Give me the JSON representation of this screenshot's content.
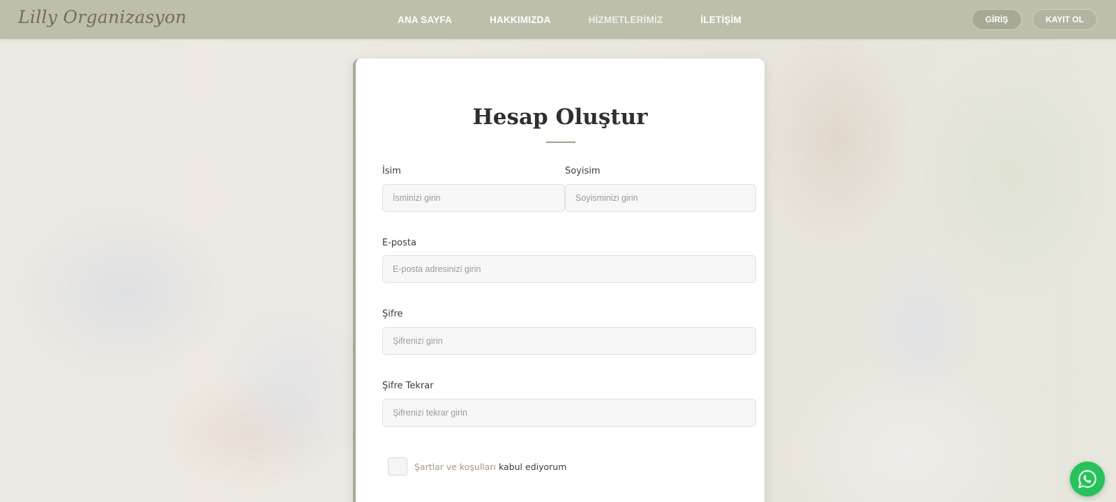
{
  "brand": {
    "name": "Lilly Organizasyon"
  },
  "nav": {
    "links": [
      {
        "label": "ANA SAYFA"
      },
      {
        "label": "HAKKIMIZDA"
      },
      {
        "label": "HİZMETLERİMİZ"
      },
      {
        "label": "İLETİŞİM"
      }
    ],
    "login_label": "GİRİŞ",
    "register_label": "KAYIT OL"
  },
  "form": {
    "title": "Hesap Oluştur",
    "first_name": {
      "label": "İsim",
      "placeholder": "İsminizi girin"
    },
    "last_name": {
      "label": "Soyisim",
      "placeholder": "Soyisminizi girin"
    },
    "email": {
      "label": "E-posta",
      "placeholder": "E-posta adresinizi girin"
    },
    "password": {
      "label": "Şifre",
      "placeholder": "Şifrenizi girin"
    },
    "password_repeat": {
      "label": "Şifre Tekrar",
      "placeholder": "Şifrenizi tekrar girin"
    },
    "terms": {
      "link_text": "Şartlar ve koşulları",
      "suffix_text": " kabul ediyorum",
      "checked": false
    }
  },
  "colors": {
    "navbar": "#bdbfaa",
    "accent": "#a7aa93",
    "whatsapp": "#25c45a"
  },
  "icons": {
    "whatsapp": "whatsapp-icon"
  }
}
